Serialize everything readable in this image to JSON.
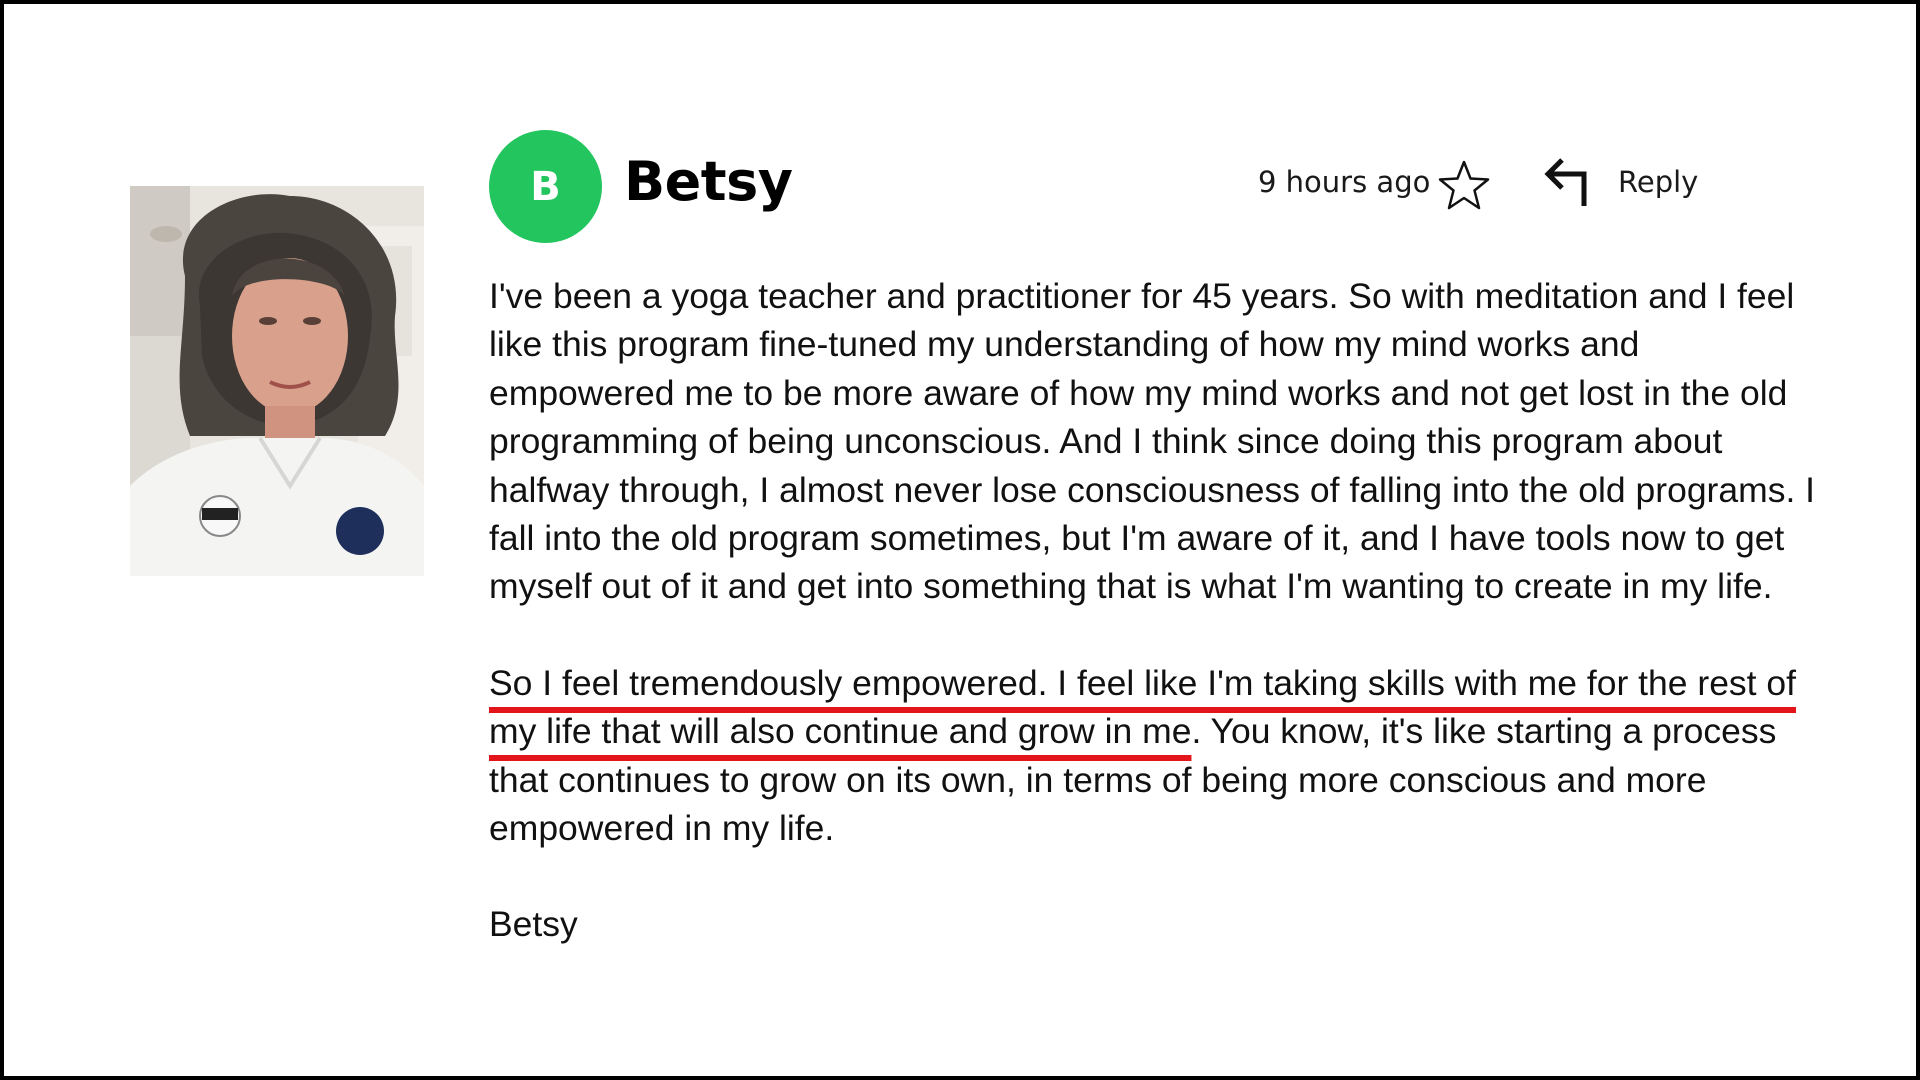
{
  "comment": {
    "author": "Betsy",
    "avatar_initial": "B",
    "timestamp": "9 hours ago",
    "reply_label": "Reply",
    "icons": {
      "star": "star-outline-icon",
      "reply": "reply-arrow-icon"
    },
    "colors": {
      "avatar_bg": "#22c55e",
      "highlight_underline": "#e3151a"
    },
    "paragraph1": "I've been a yoga teacher and practitioner for 45 years. So with meditation and I feel like this program fine-tuned my understanding of how my mind works and empowered me to be more aware of how my mind works and not get lost in the old programming of being unconscious. And I think since doing this program about halfway through, I almost never lose consciousness of falling into the old programs. I fall into the old program sometimes, but I'm aware of it, and I have tools now to get myself out of it and get into something that is what I'm wanting to create in my life.",
    "paragraph2_highlight": "So I feel tremendously empowered. I feel like I'm taking skills with me for the rest of my life that will also continue and grow in me",
    "paragraph2_rest": ". You know, it's like starting a process that continues to grow on its own, in terms of being more conscious and more empowered in my life.",
    "signature": "Betsy"
  }
}
